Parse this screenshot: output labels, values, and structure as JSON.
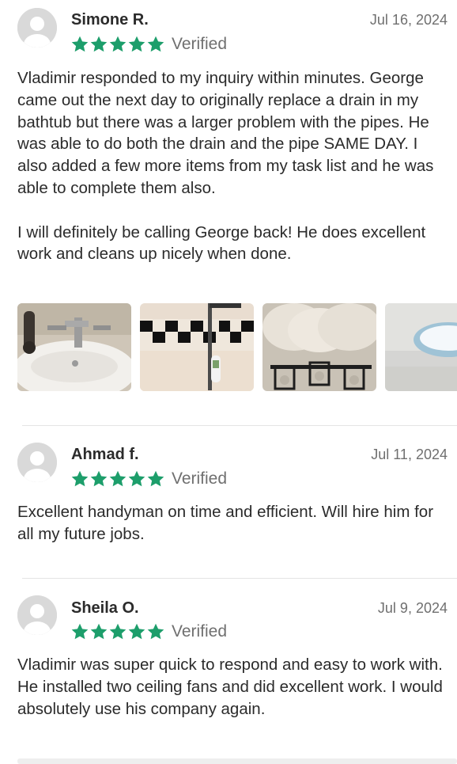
{
  "colors": {
    "star": "#1d9e6b",
    "muted": "#6f6f6f",
    "text": "#2b2b2b"
  },
  "reviews": [
    {
      "name": "Simone R.",
      "date": "Jul 16, 2024",
      "rating": 5,
      "verified_label": "Verified",
      "body": "Vladimir responded to my inquiry within minutes. George came out the next day to originally replace a drain in my bathtub but there was a larger problem with the pipes. He was able to do both the drain and the pipe SAME DAY. I also added a few more items from my task list and he was able to complete them also.\n\nI will definitely be calling George back! He does excellent work and cleans up nicely when done.",
      "photos": [
        "bathroom-faucet-photo",
        "checkered-tile-shower-photo",
        "vanity-light-fixture-photo",
        "ceiling-fan-light-photo"
      ]
    },
    {
      "name": "Ahmad f.",
      "date": "Jul 11, 2024",
      "rating": 5,
      "verified_label": "Verified",
      "body": "Excellent handyman on time and efficient.  Will hire him for all my future jobs."
    },
    {
      "name": "Sheila O.",
      "date": "Jul 9, 2024",
      "rating": 5,
      "verified_label": "Verified",
      "body": "Vladimir was super quick to respond and easy to work with. He installed two ceiling fans and did excellent work. I would absolutely use his company again."
    }
  ]
}
